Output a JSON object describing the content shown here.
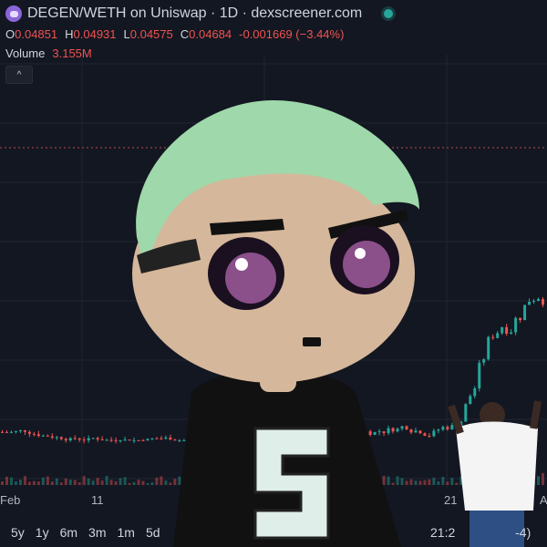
{
  "header": {
    "title": "DEGEN/WETH on Uniswap · 1D · dexscreener.com",
    "ohlc": {
      "o_label": "O",
      "o": "0.04851",
      "h_label": "H",
      "h": "0.04931",
      "l_label": "L",
      "l": "0.04575",
      "c_label": "C",
      "c": "0.04684",
      "change": "-0.001669 (−3.44%)"
    },
    "volume_label": "Volume",
    "volume_value": "3.155M",
    "collapse_icon": "^"
  },
  "x_axis": {
    "labels": [
      "Feb",
      "11",
      "21",
      "A"
    ]
  },
  "timeframes": [
    "5y",
    "1y",
    "6m",
    "3m",
    "1m",
    "5d"
  ],
  "clock": "21:2",
  "clock_tail": "-4)",
  "colors": {
    "up": "#26a69a",
    "down": "#ef5350",
    "bg": "#131722",
    "grid": "#1f2430",
    "hair": "#b84a52"
  },
  "chart_data": {
    "type": "candlestick",
    "up_closes": [
      0.0468,
      0.047,
      0.0475,
      0.0481,
      0.0472,
      0.0478,
      0.0485,
      0.049,
      0.0479,
      0.0473,
      0.0471,
      0.0482,
      0.0486,
      0.048,
      0.0477,
      0.0474,
      0.048,
      0.0487,
      0.0494,
      0.0505,
      0.052,
      0.0545,
      0.0561,
      0.0578,
      0.06,
      0.0625,
      0.064,
      0.066,
      0.067,
      0.07,
      0.069,
      0.072,
      0.076,
      0.08,
      0.084,
      0.088,
      0.093,
      0.099
    ]
  }
}
